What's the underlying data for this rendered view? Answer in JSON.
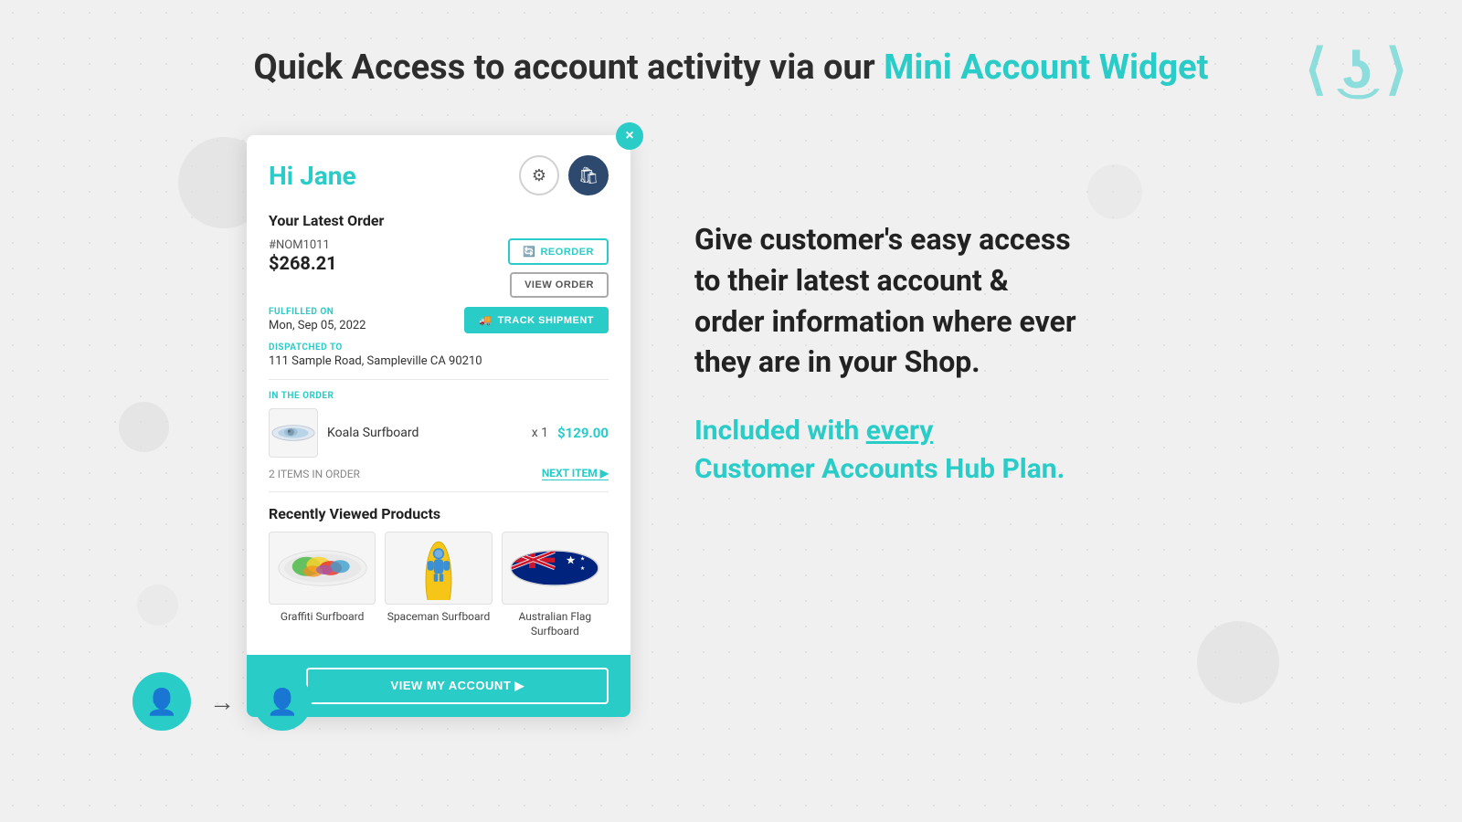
{
  "page": {
    "title_part1": "Quick Access to account activity via our ",
    "title_accent": "Mini Account Widget",
    "brand_icon": "⟨"
  },
  "widget": {
    "close_btn": "×",
    "greeting": "Hi Jane",
    "settings_icon": "⚙",
    "cart_icon": "🛍",
    "latest_order_title": "Your Latest Order",
    "order_number": "#NOM1011",
    "order_amount": "$268.21",
    "btn_reorder": "REORDER",
    "btn_view_order": "VIEW ORDER",
    "fulfilled_label": "FULFILLED ON",
    "fulfilled_date": "Mon, Sep 05, 2022",
    "dispatched_label": "DISPATCHED TO",
    "dispatched_address": "111 Sample Road, Sampleville CA 90210",
    "btn_track": "TRACK SHIPMENT",
    "in_order_label": "IN THE ORDER",
    "item_name": "Koala Surfboard",
    "item_qty": "x 1",
    "item_price": "$129.00",
    "items_count": "2 ITEMS IN ORDER",
    "next_item": "NEXT ITEM ▶",
    "recently_viewed_title": "Recently Viewed Products",
    "products": [
      {
        "name": "Graffiti Surfboard"
      },
      {
        "name": "Spaceman Surfboard"
      },
      {
        "name": "Australian Flag Surfboard"
      }
    ],
    "footer_btn": "VIEW MY ACCOUNT ▶"
  },
  "right": {
    "main_text": "Give customer's easy access\nto their latest account &\norder information where ever\nthey are in your Shop.",
    "sub_line1": "Included with ",
    "sub_every": "every",
    "sub_line2": "\nCustomer Accounts Hub Plan."
  }
}
